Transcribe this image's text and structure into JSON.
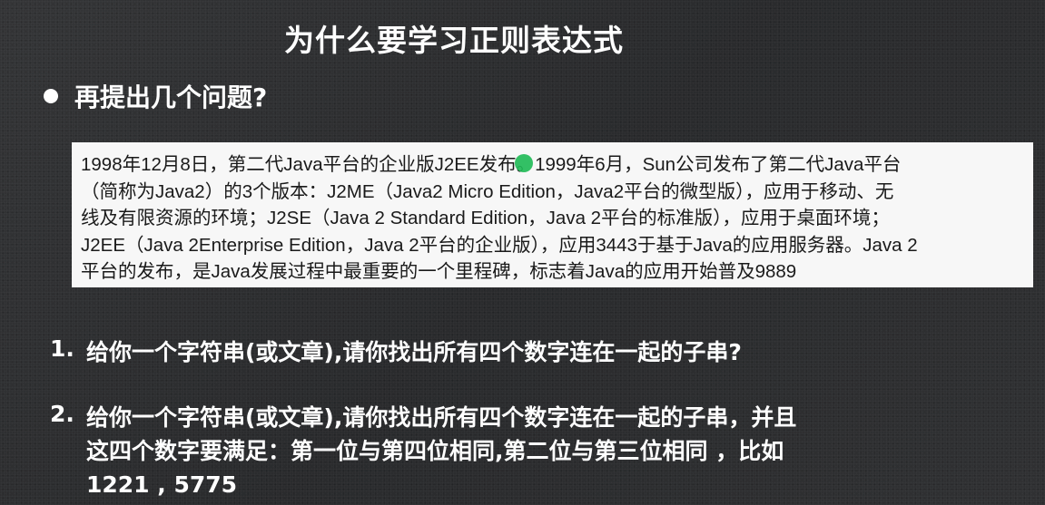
{
  "slide": {
    "title": "为什么要学习正则表达式",
    "bullet": "再提出几个问题?"
  },
  "sample_text": {
    "lines": [
      "1998年12月8日，第二代Java平台的企业版J2EE发布。1999年6月，Sun公司发布了第二代Java平台",
      "（简称为Java2）的3个版本：J2ME（Java2 Micro Edition，Java2平台的微型版），应用于移动、无",
      "线及有限资源的环境；J2SE（Java 2 Standard Edition，Java 2平台的标准版），应用于桌面环境；",
      "J2EE（Java 2Enterprise Edition，Java 2平台的企业版），应用3443于基于Java的应用服务器。Java 2",
      "平台的发布，是Java发展过程中最重要的一个里程碑，标志着Java的应用开始普及9889"
    ]
  },
  "questions": [
    {
      "number": "1.",
      "lines": [
        "给你一个字符串(或文章),请你找出所有四个数字连在一起的子串?"
      ]
    },
    {
      "number": "2.",
      "lines": [
        "给你一个字符串(或文章),请你找出所有四个数字连在一起的子串，并且",
        "这四个数字要满足：第一位与第四位相同,第二位与第三位相同 ，比如",
        "1221 , 5775"
      ]
    }
  ],
  "colors": {
    "background": "#2e2f31",
    "text": "#ffffff",
    "box": "#f7f7f7",
    "cursor": "#1db954"
  }
}
